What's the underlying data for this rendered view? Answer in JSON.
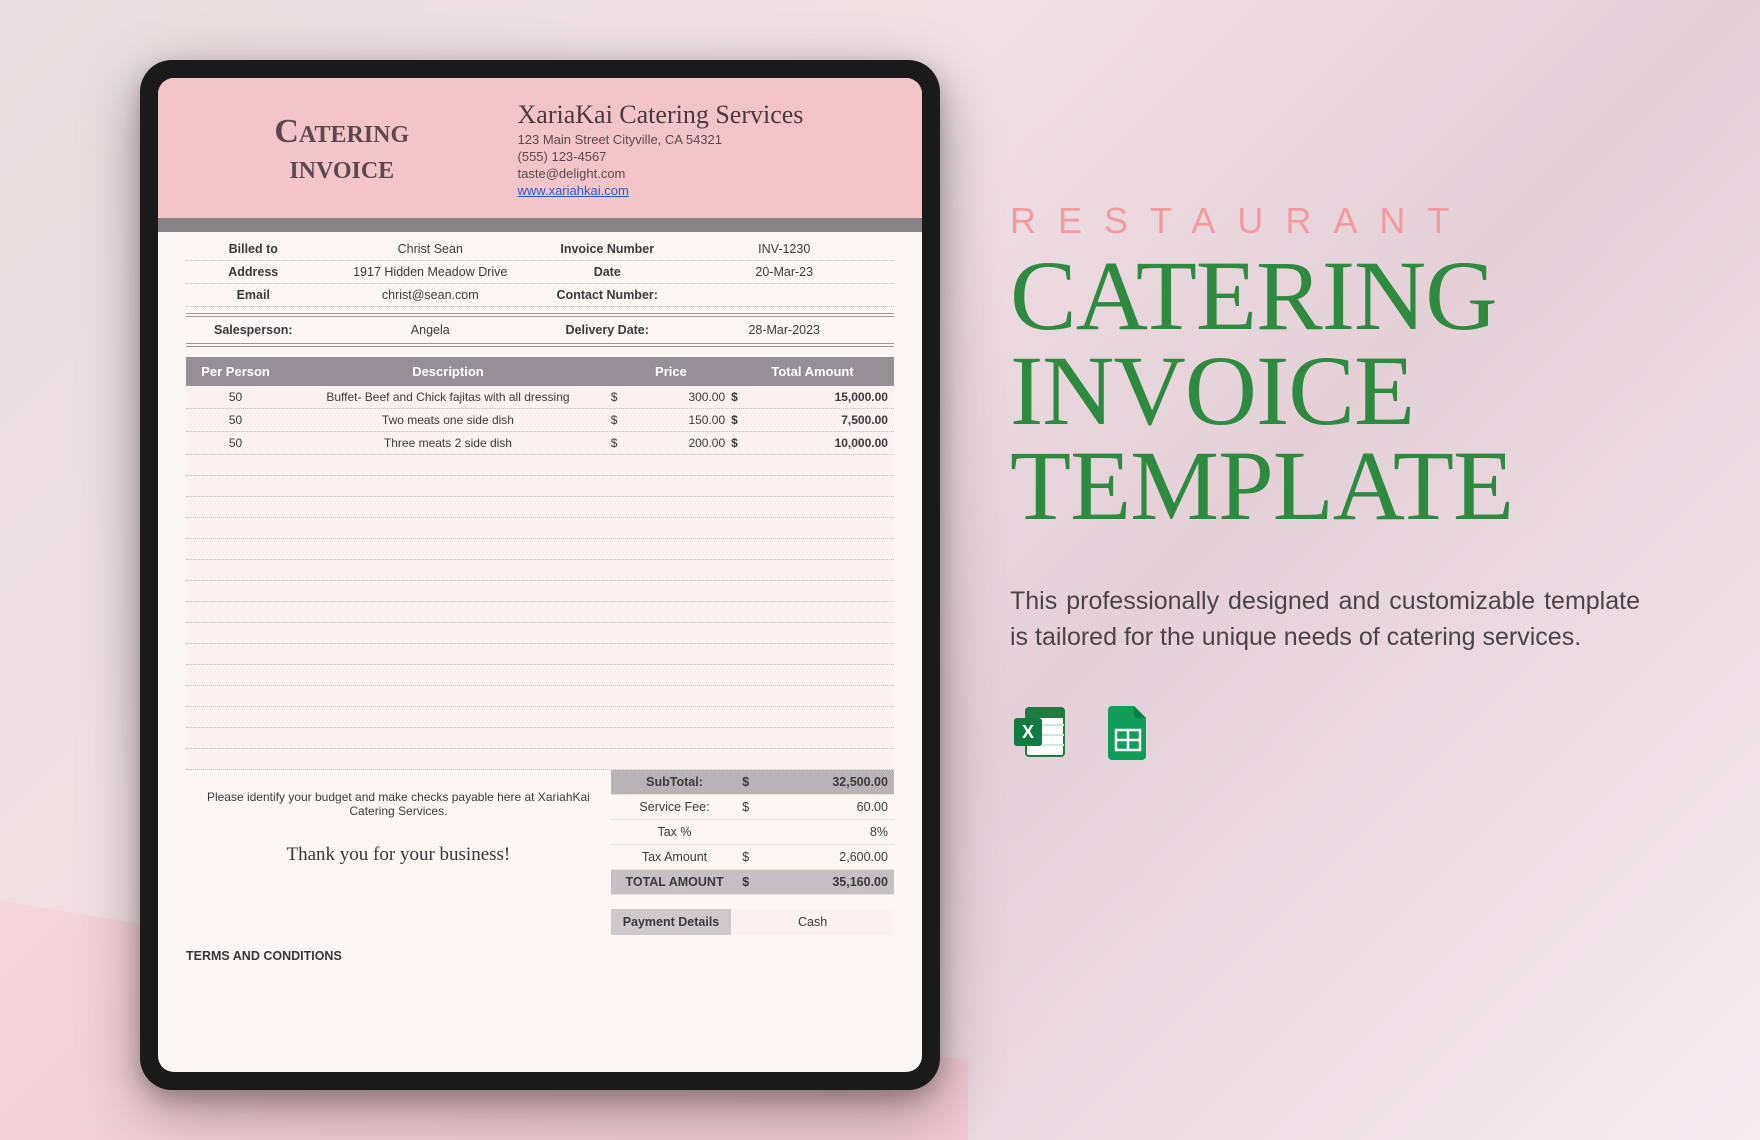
{
  "promo": {
    "kicker": "RESTAURANT",
    "title": "CATERING INVOICE TEMPLATE",
    "description": "This professionally designed and customizable template is tailored for the unique needs of catering services.",
    "icons": [
      "excel",
      "google-sheets"
    ]
  },
  "invoice": {
    "header": {
      "title_line1": "Catering",
      "title_line2": "invoice"
    },
    "company": {
      "name": "XariaKai Catering Services",
      "address": "123 Main Street Cityville, CA 54321",
      "phone": "(555) 123-4567",
      "email": "taste@delight.com",
      "website": "www.xariahkai.com"
    },
    "meta": {
      "labels": {
        "billed_to": "Billed to",
        "address": "Address",
        "email": "Email",
        "invoice_number": "Invoice Number",
        "date": "Date",
        "contact_number": "Contact Number:",
        "salesperson": "Salesperson:",
        "delivery_date": "Delivery Date:"
      },
      "billed_to": "Christ Sean",
      "address": "1917 Hidden Meadow Drive",
      "email": "christ@sean.com",
      "invoice_number": "INV-1230",
      "date": "20-Mar-23",
      "contact_number": "",
      "salesperson": "Angela",
      "delivery_date": "28-Mar-2023"
    },
    "columns": {
      "per_person": "Per Person",
      "description": "Description",
      "price": "Price",
      "total_amount": "Total Amount"
    },
    "currency": "$",
    "items": [
      {
        "per_person": "50",
        "description": "Buffet- Beef and Chick fajitas with all dressing",
        "price": "300.00",
        "total": "15,000.00"
      },
      {
        "per_person": "50",
        "description": "Two meats one side dish",
        "price": "150.00",
        "total": "7,500.00"
      },
      {
        "per_person": "50",
        "description": "Three meats 2 side dish",
        "price": "200.00",
        "total": "10,000.00"
      }
    ],
    "empty_rows": 15,
    "footer_message": "Please identify your budget and make checks payable here at XariahKai Catering Services.",
    "thanks": "Thank you for your business!",
    "summary": {
      "labels": {
        "subtotal": "SubTotal:",
        "service_fee": "Service Fee:",
        "tax_pct": "Tax %",
        "tax_amount": "Tax Amount",
        "total": "TOTAL AMOUNT",
        "payment_details": "Payment Details"
      },
      "subtotal": "32,500.00",
      "service_fee": "60.00",
      "tax_pct": "8%",
      "tax_amount": "2,600.00",
      "total": "35,160.00",
      "payment_details": "Cash"
    },
    "terms_label": "TERMS AND CONDITIONS"
  }
}
